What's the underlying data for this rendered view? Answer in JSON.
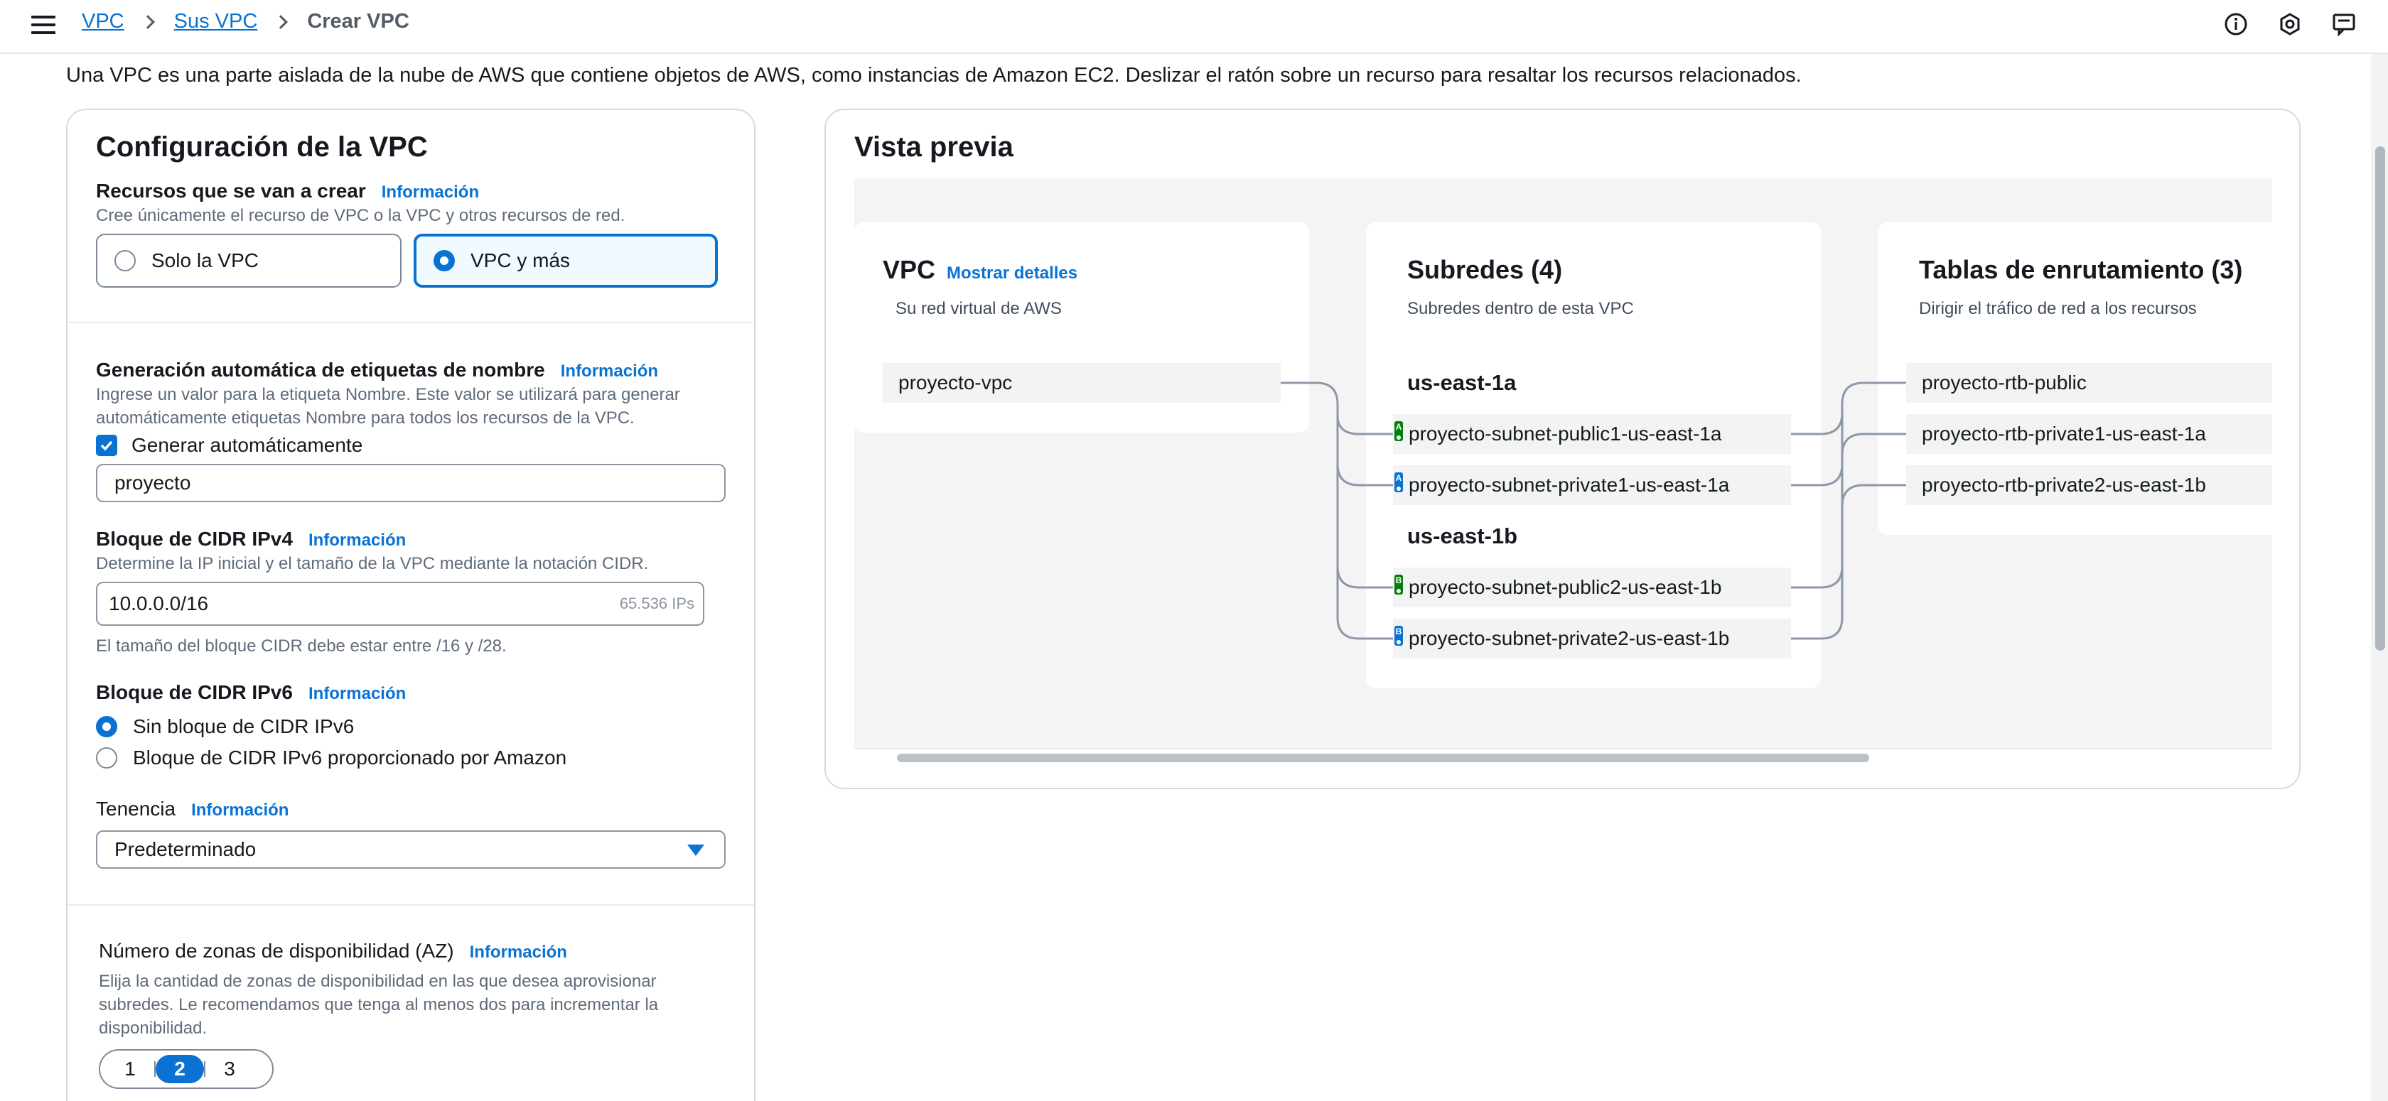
{
  "breadcrumb": {
    "items": [
      "VPC",
      "Sus VPC"
    ],
    "current": "Crear VPC"
  },
  "intro": "Una VPC es una parte aislada de la nube de AWS que contiene objetos de AWS, como instancias de Amazon EC2. Deslizar el ratón sobre un recurso para resaltar los recursos relacionados.",
  "config": {
    "title": "Configuración de la VPC",
    "info_label": "Información",
    "resources": {
      "label": "Recursos que se van a crear",
      "desc": "Cree únicamente el recurso de VPC o la VPC y otros recursos de red.",
      "options": [
        "Solo la VPC",
        "VPC y más"
      ],
      "selected": "VPC y más"
    },
    "name_tag": {
      "label": "Generación automática de etiquetas de nombre",
      "desc_line1": "Ingrese un valor para la etiqueta Nombre. Este valor se utilizará para generar",
      "desc_line2": "automáticamente etiquetas Nombre para todos los recursos de la VPC.",
      "checkbox_label": "Generar automáticamente",
      "checked": true,
      "value": "proyecto"
    },
    "ipv4": {
      "label": "Bloque de CIDR IPv4",
      "desc": "Determine la IP inicial y el tamaño de la VPC mediante la notación CIDR.",
      "value": "10.0.0.0/16",
      "suffix": "65.536 IPs",
      "constraint": "El tamaño del bloque CIDR debe estar entre /16 y /28."
    },
    "ipv6": {
      "label": "Bloque de CIDR IPv6",
      "options": [
        "Sin bloque de CIDR IPv6",
        "Bloque de CIDR IPv6 proporcionado por Amazon"
      ],
      "selected": "Sin bloque de CIDR IPv6"
    },
    "tenancy": {
      "label": "Tenencia",
      "value": "Predeterminado"
    },
    "az": {
      "label": "Número de zonas de disponibilidad (AZ)",
      "desc_line1": "Elija la cantidad de zonas de disponibilidad en las que desea aprovisionar",
      "desc_line2": "subredes. Le recomendamos que tenga al menos dos para incrementar la",
      "desc_line3": "disponibilidad.",
      "options": [
        "1",
        "2",
        "3"
      ],
      "selected": "2"
    }
  },
  "preview": {
    "title": "Vista previa",
    "vpc": {
      "title": "VPC",
      "details_link": "Mostrar detalles",
      "subtitle": "Su red virtual de AWS",
      "name": "proyecto-vpc"
    },
    "subnets": {
      "title": "Subredes (4)",
      "subtitle": "Subredes dentro de esta VPC",
      "zones": [
        {
          "name": "us-east-1a",
          "items": [
            {
              "badge": "A",
              "name": "proyecto-subnet-public1-us-east-1a"
            },
            {
              "badge": "A",
              "name": "proyecto-subnet-private1-us-east-1a"
            }
          ]
        },
        {
          "name": "us-east-1b",
          "items": [
            {
              "badge": "B",
              "name": "proyecto-subnet-public2-us-east-1b"
            },
            {
              "badge": "B",
              "name": "proyecto-subnet-private2-us-east-1b"
            }
          ]
        }
      ]
    },
    "route_tables": {
      "title": "Tablas de enrutamiento (3)",
      "subtitle": "Dirigir el tráfico de red a los recursos",
      "items": [
        "proyecto-rtb-public",
        "proyecto-rtb-private1-us-east-1a",
        "proyecto-rtb-private2-us-east-1b"
      ]
    }
  },
  "colors": {
    "accent": "#0972d3",
    "badge_public": "#037f0c",
    "badge_private": "#0972d3",
    "canvas": "#f4f4f4"
  },
  "icons": [
    "menu-icon",
    "info-circle-icon",
    "settings-hex-icon",
    "feedback-icon",
    "chevron-right-icon",
    "dropdown-caret-icon",
    "checkmark-icon"
  ]
}
